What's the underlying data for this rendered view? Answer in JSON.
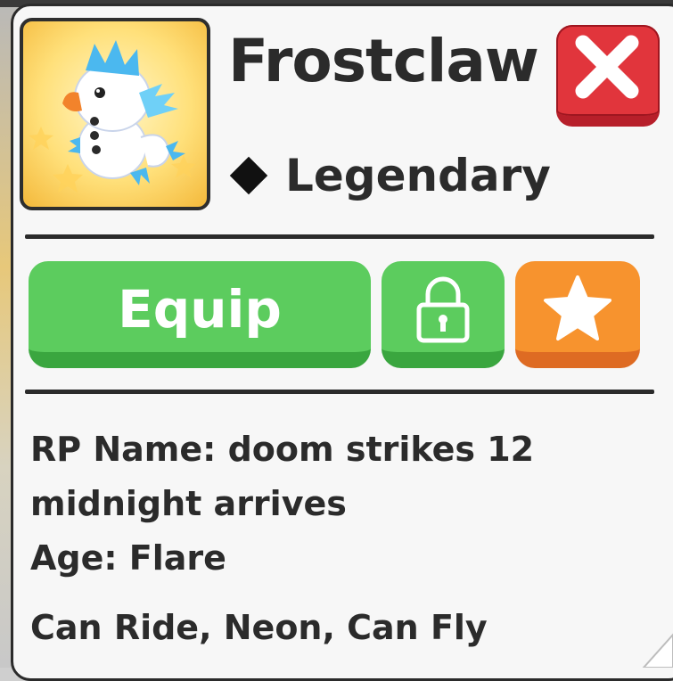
{
  "pet": {
    "name": "Frostclaw",
    "rarity": "Legendary",
    "image_icon": "frostclaw-pet-icon"
  },
  "buttons": {
    "equip_label": "Equip",
    "lock_icon": "lock-icon",
    "favorite_icon": "star-icon",
    "close_icon": "close-icon"
  },
  "info": {
    "rp_name_line1": "RP Name: doom strikes 12",
    "rp_name_line2": "midnight arrives",
    "age": "Age: Flare",
    "flags": "Can Ride, Neon, Can Fly"
  },
  "colors": {
    "equip_green": "#5ccc5e",
    "close_red": "#e1353c",
    "favorite_orange": "#f7932e"
  }
}
